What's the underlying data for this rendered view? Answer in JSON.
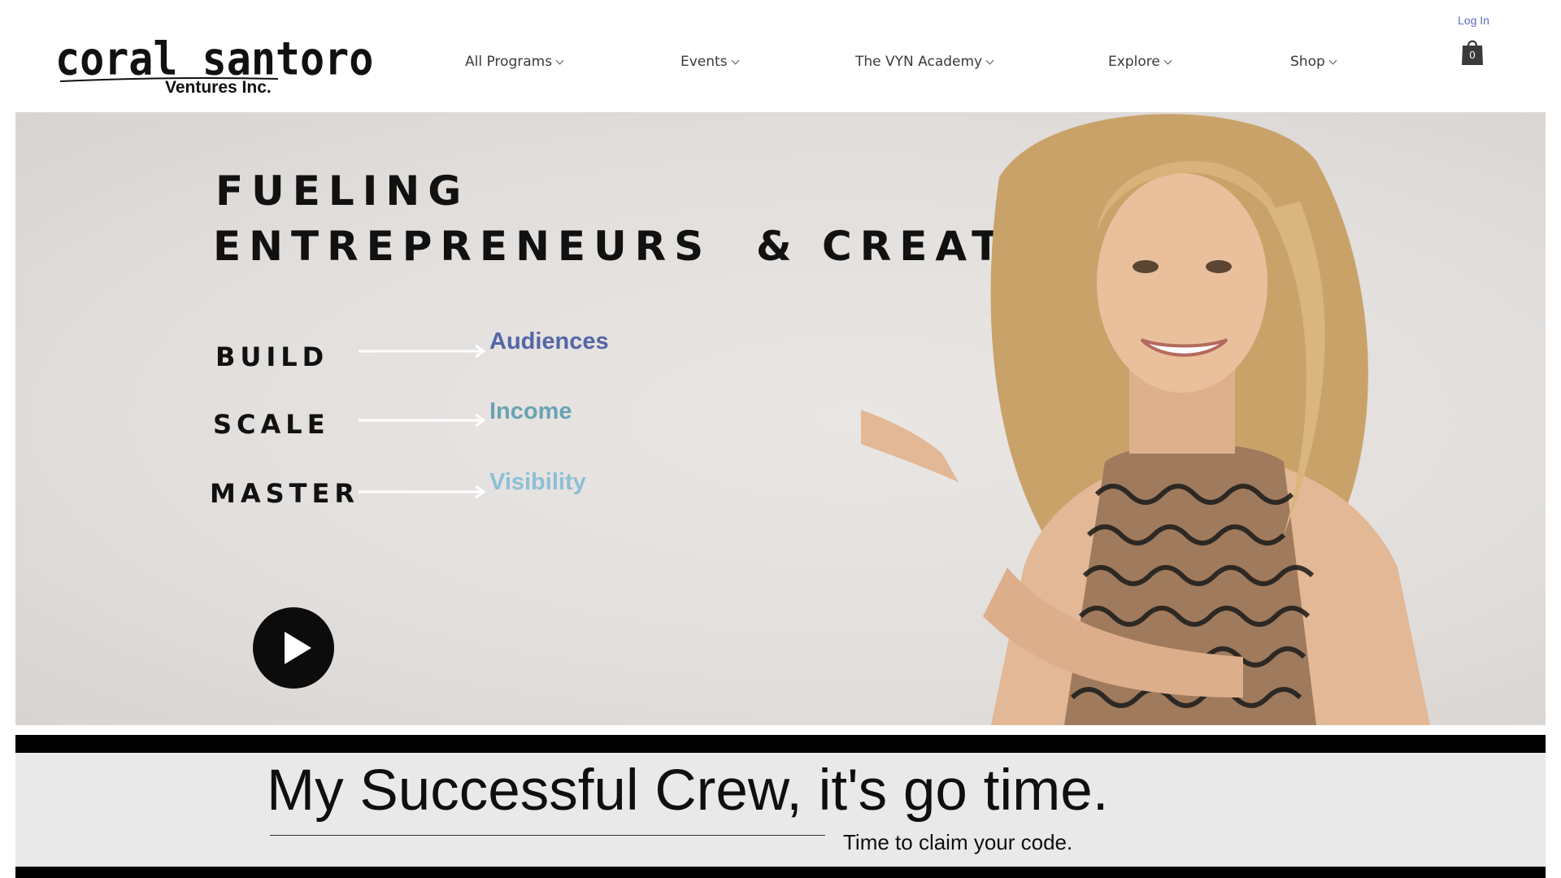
{
  "header": {
    "logo": {
      "main": "coral santoro",
      "sub": "Ventures Inc."
    },
    "nav": [
      {
        "label": "All Programs"
      },
      {
        "label": "Events"
      },
      {
        "label": "The VYN Academy"
      },
      {
        "label": "Explore"
      },
      {
        "label": "Shop"
      }
    ],
    "login_label": "Log In",
    "cart_count": "0"
  },
  "hero": {
    "title_line1": "FUELING",
    "title_line2": "ENTREPRENEURS  & CREATORS",
    "rows": [
      {
        "verb": "BUILD",
        "outcome": "Audiences",
        "color": "#5565a8"
      },
      {
        "verb": "SCALE",
        "outcome": "Income",
        "color": "#6aa3b3"
      },
      {
        "verb": "MASTER",
        "outcome": "Visibility",
        "color": "#8dbfd6"
      }
    ]
  },
  "banner": {
    "headline": "My Successful Crew, it's go time.",
    "subline": "Time to claim your code."
  },
  "colors": {
    "login_link": "#5b6bc4",
    "hero_bg": "#e2dfdd",
    "banner_bg": "#e9e9e9"
  }
}
